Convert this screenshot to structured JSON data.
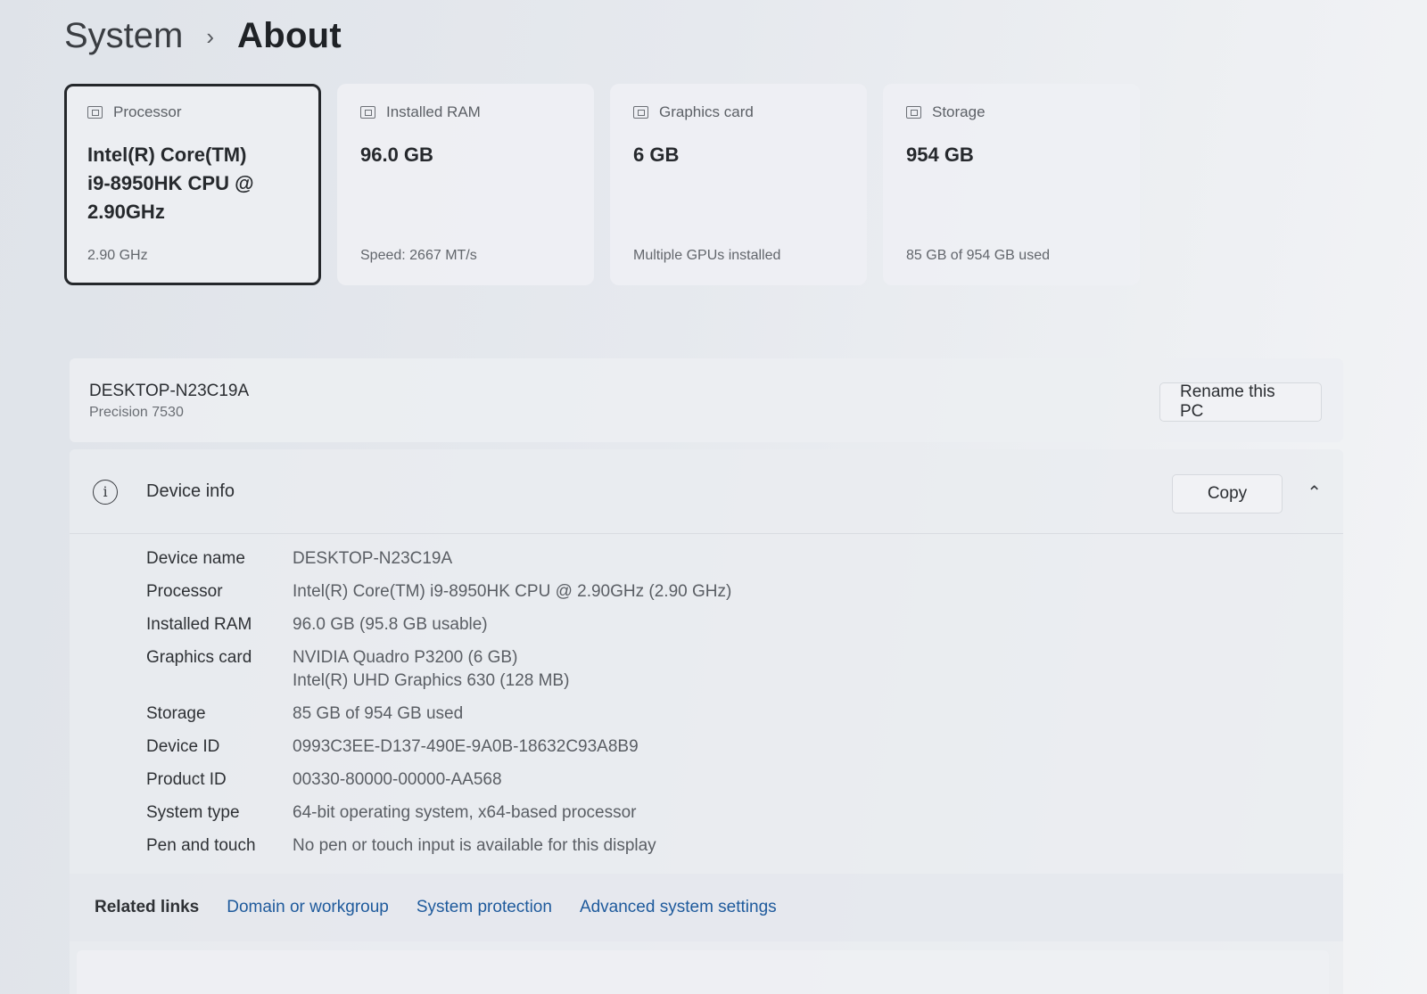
{
  "breadcrumb": {
    "parent": "System",
    "separator": "›",
    "current": "About"
  },
  "spec_cards": [
    {
      "icon": "processor-icon",
      "label": "Processor",
      "value": "Intel(R) Core(TM) i9-8950HK CPU @ 2.90GHz",
      "sub": "2.90 GHz",
      "selected": true
    },
    {
      "icon": "ram-icon",
      "label": "Installed RAM",
      "value": "96.0 GB",
      "sub": "Speed: 2667 MT/s",
      "selected": false
    },
    {
      "icon": "graphics-card-icon",
      "label": "Graphics card",
      "value": "6 GB",
      "sub": "Multiple GPUs installed",
      "selected": false
    },
    {
      "icon": "storage-icon",
      "label": "Storage",
      "value": "954 GB",
      "sub": "85 GB of 954 GB used",
      "selected": false
    }
  ],
  "pc": {
    "name": "DESKTOP-N23C19A",
    "model": "Precision 7530",
    "rename_label": "Rename this PC"
  },
  "device_info": {
    "title": "Device info",
    "copy_label": "Copy",
    "expanded": true,
    "rows": [
      {
        "label": "Device name",
        "value": "DESKTOP-N23C19A"
      },
      {
        "label": "Processor",
        "value": "Intel(R) Core(TM) i9-8950HK CPU @ 2.90GHz (2.90 GHz)"
      },
      {
        "label": "Installed RAM",
        "value": "96.0 GB (95.8 GB usable)"
      },
      {
        "label": "Graphics card",
        "value": "NVIDIA Quadro P3200 (6 GB)",
        "value2": "Intel(R) UHD Graphics 630 (128 MB)"
      },
      {
        "label": "Storage",
        "value": "85 GB of 954 GB used"
      },
      {
        "label": "Device ID",
        "value": "0993C3EE-D137-490E-9A0B-18632C93A8B9"
      },
      {
        "label": "Product ID",
        "value": "00330-80000-00000-AA568"
      },
      {
        "label": "System type",
        "value": "64-bit operating system, x64-based processor"
      },
      {
        "label": "Pen and touch",
        "value": "No pen or touch input is available for this display"
      }
    ]
  },
  "related_links": {
    "label": "Related links",
    "links": [
      "Domain or workgroup",
      "System protection",
      "Advanced system settings"
    ]
  },
  "colors": {
    "link": "#1e5a9c",
    "selected_border": "#24272b",
    "text_primary": "#2b2d31",
    "text_secondary": "#5a5e64"
  }
}
